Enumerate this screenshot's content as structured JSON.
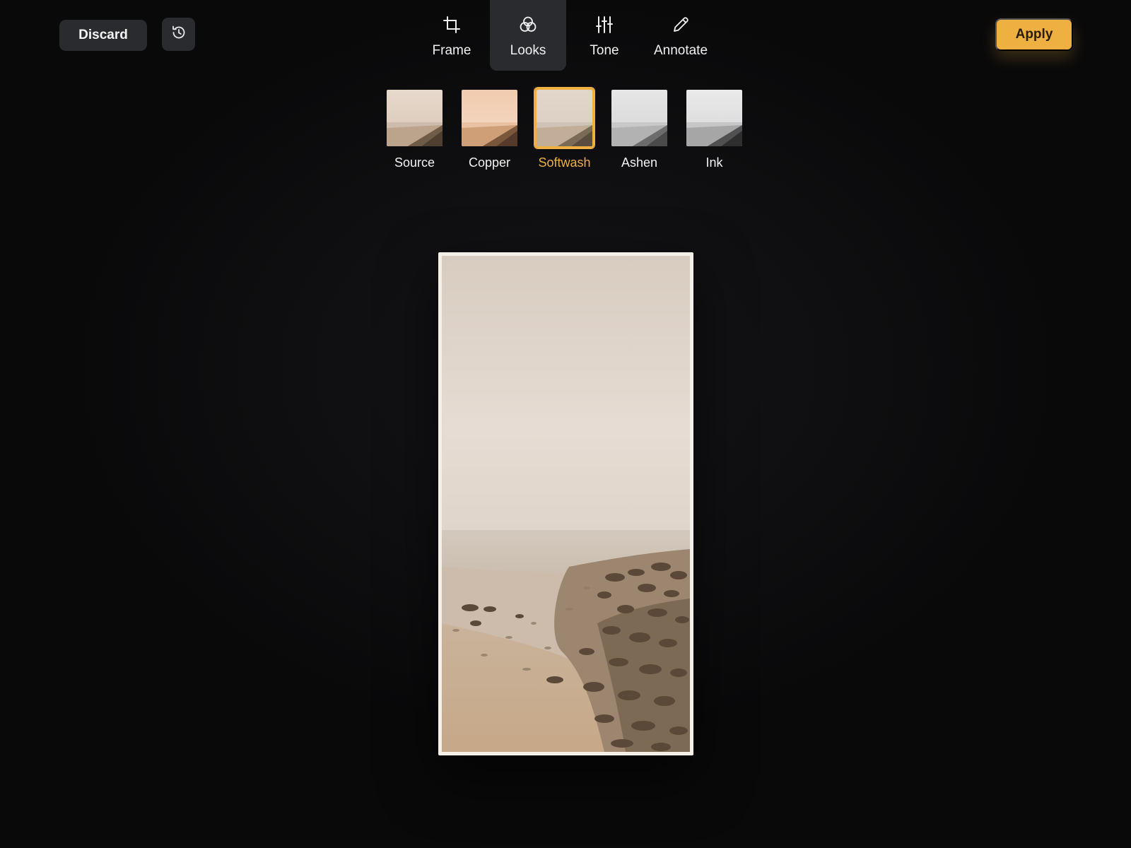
{
  "toolbar": {
    "discard_label": "Discard",
    "history_icon": "history-icon",
    "apply_label": "Apply",
    "accent_color": "#eeb040"
  },
  "tabs": [
    {
      "label": "Frame",
      "icon": "crop-icon",
      "active": false
    },
    {
      "label": "Looks",
      "icon": "looks-icon",
      "active": true
    },
    {
      "label": "Tone",
      "icon": "sliders-icon",
      "active": false
    },
    {
      "label": "Annotate",
      "icon": "pencil-icon",
      "active": false
    }
  ],
  "looks": [
    {
      "label": "Source",
      "active": false
    },
    {
      "label": "Copper",
      "active": false
    },
    {
      "label": "Softwash",
      "active": true
    },
    {
      "label": "Ashen",
      "active": false
    },
    {
      "label": "Ink",
      "active": false
    }
  ]
}
